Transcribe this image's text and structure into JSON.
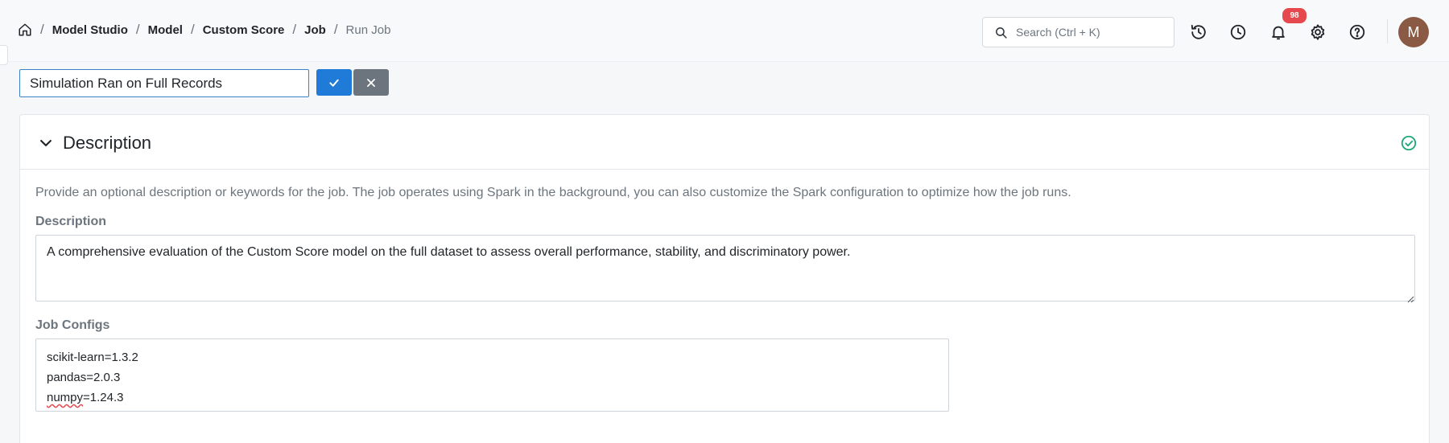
{
  "breadcrumb": {
    "items": [
      "Model Studio",
      "Model",
      "Custom Score",
      "Job"
    ],
    "current": "Run Job",
    "separator": "/"
  },
  "header": {
    "search_placeholder": "Search (Ctrl + K)",
    "notification_count": "98",
    "avatar_initial": "M"
  },
  "job_name": {
    "value": "Simulation Ran on Full Records"
  },
  "section": {
    "title": "Description",
    "helper_text": "Provide an optional description or keywords for the job. The job operates using Spark in the background, you can also customize the Spark configuration to optimize how the job runs.",
    "description_label": "Description",
    "description_value": "A comprehensive evaluation of the Custom Score model on the full dataset to assess overall performance, stability, and discriminatory power.",
    "configs_label": "Job Configs",
    "configs": [
      {
        "name": "scikit-learn",
        "version": "1.3.2"
      },
      {
        "name": "pandas",
        "version": "2.0.3"
      },
      {
        "name": "numpy",
        "version": "1.24.3"
      }
    ]
  },
  "colors": {
    "primary": "#1f7ad8",
    "secondary": "#6c757d",
    "badge": "#e5484d",
    "success": "#20a878",
    "avatar": "#8a5a44"
  }
}
